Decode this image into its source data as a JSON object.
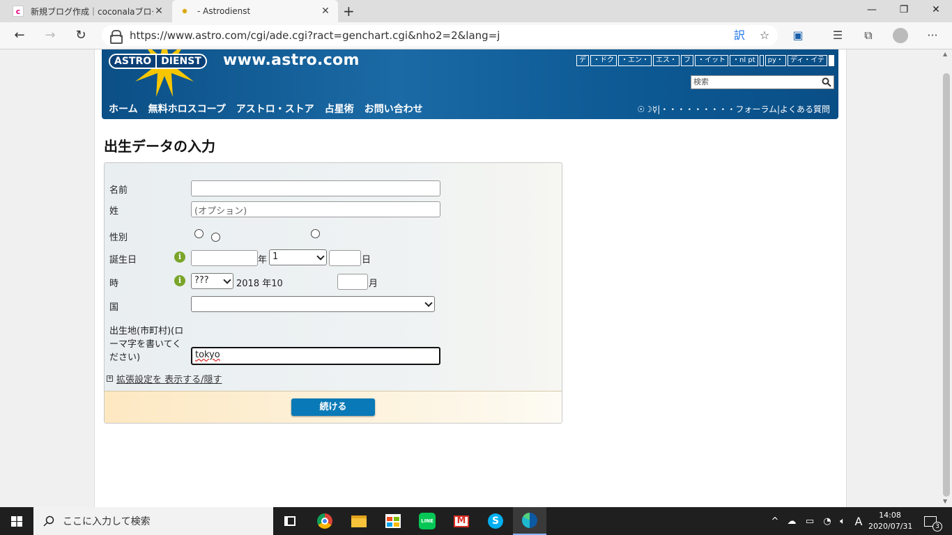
{
  "browser": {
    "tabs": [
      {
        "title": "新規ブログ作成｜coconalaブログ",
        "active": false
      },
      {
        "title": "- Astrodienst",
        "active": true
      }
    ],
    "url": "https://www.astro.com/cgi/ade.cgi?ract=genchart.cgi&nho2=2&lang=j"
  },
  "site": {
    "logo_left": "ASTRO",
    "logo_right": "DIENST",
    "site_url": "www.astro.com",
    "languages": [
      "デ",
      "・ドク",
      "・エン・",
      "エス・",
      "フ",
      "・イット",
      "・nl pt",
      "",
      "py・",
      "ディ・イテ"
    ],
    "search_placeholder": "検索",
    "nav": [
      "ホーム",
      "無料ホロスコープ",
      "アストロ・ストア",
      "占星術",
      "お問い合わせ"
    ],
    "subnav": "☉☽☿|・・・・・・・・・フォーラム|よくある質問"
  },
  "form": {
    "page_title": "出生データの入力",
    "name_label": "名前",
    "surname_label": "姓",
    "surname_placeholder": "(オプション)",
    "gender_label": "性別",
    "birthdate_label": "誕生日",
    "year_suffix": "年",
    "month_selected": "1",
    "day_suffix": "日",
    "time_label": "時",
    "hour_selected": "???",
    "time_text": "2018 年10",
    "minute_suffix": "月",
    "country_label": "国",
    "country_selected": "",
    "city_label_line1": "出生地(市町村)(ロ",
    "city_label_line2": "ーマ字を書いてく",
    "city_label_line3": "ださい)",
    "city_value": "tokyo",
    "advanced_link": "拡張設定を 表示する/隠す",
    "continue_button": "続ける"
  },
  "taskbar": {
    "search_placeholder": "ここに入力して検索",
    "ime": "A",
    "time": "14:08",
    "date": "2020/07/31",
    "notifications": "3"
  }
}
